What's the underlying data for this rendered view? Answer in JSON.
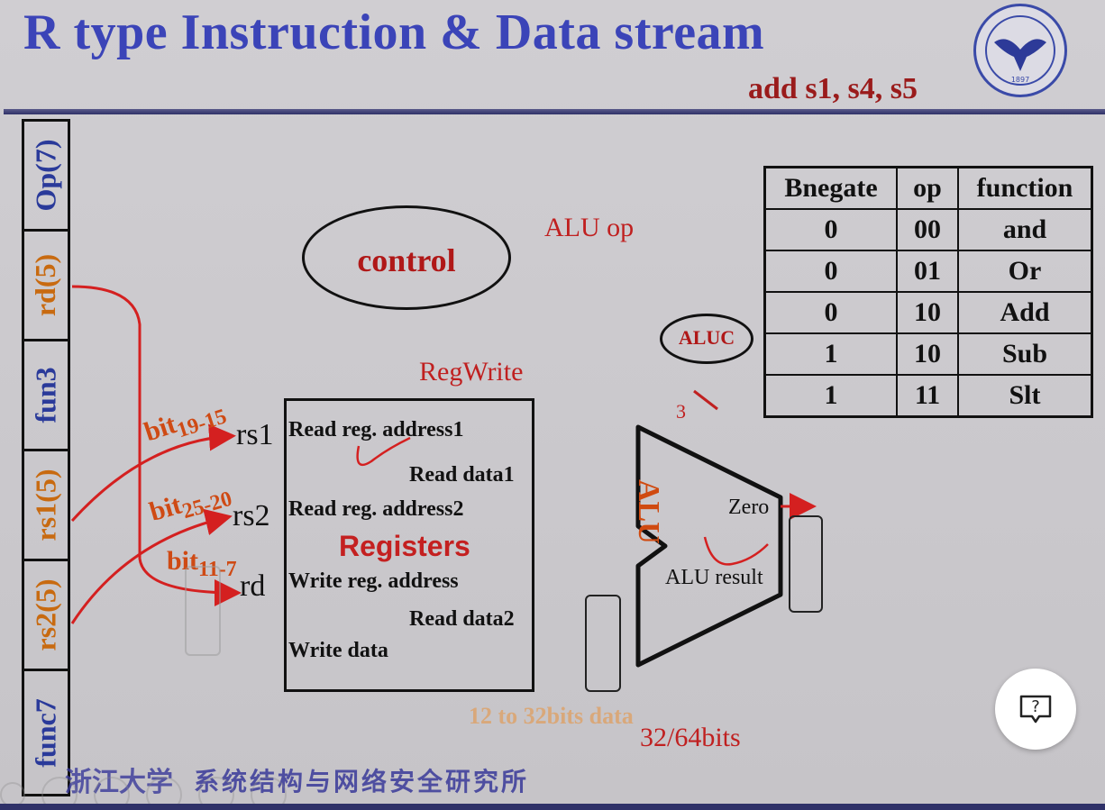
{
  "slide": {
    "title": "R type Instruction & Data stream",
    "instruction": "add  s1, s4, s5",
    "logo_text": "ZHEJIANG UNIVERSITY",
    "logo_year": "1897"
  },
  "instruction_fields": [
    {
      "label": "Op(7)",
      "color": "#2a3a9a"
    },
    {
      "label": "rd(5)",
      "color": "#c86a10"
    },
    {
      "label": "fun3",
      "color": "#2a3a9a"
    },
    {
      "label": "rs1(5)",
      "color": "#c86a10"
    },
    {
      "label": "rs2(5)",
      "color": "#c86a10"
    },
    {
      "label": "func7",
      "color": "#2a3a9a"
    }
  ],
  "control": {
    "label": "control"
  },
  "signals": {
    "alu_op": "ALU op",
    "reg_write": "RegWrite",
    "aluc": "ALUC",
    "aluc_width": "3"
  },
  "bit_labels": {
    "rs1": {
      "prefix": "bit",
      "range": "19-15"
    },
    "rs2": {
      "prefix": "bit",
      "range": "25-20"
    },
    "rd": {
      "prefix": "bit",
      "range": "11-7"
    }
  },
  "ports": {
    "rs1": "rs1",
    "rs2": "rs2",
    "rd": "rd"
  },
  "registers": {
    "name": "Registers",
    "read_addr1": "Read reg. address1",
    "read_data1": "Read data1",
    "read_addr2": "Read reg. address2",
    "write_addr": "Write reg. address",
    "read_data2": "Read data2",
    "write_data": "Write data"
  },
  "alu": {
    "label": "ALU",
    "zero": "Zero",
    "result": "ALU result"
  },
  "truth_table": {
    "headers": [
      "Bnegate",
      "op",
      "function"
    ],
    "rows": [
      [
        "0",
        "00",
        "and"
      ],
      [
        "0",
        "01",
        "Or"
      ],
      [
        "0",
        "10",
        "Add"
      ],
      [
        "1",
        "10",
        "Sub"
      ],
      [
        "1",
        "11",
        "Slt"
      ]
    ]
  },
  "notes": {
    "imm_data": "12 to 32bits data",
    "width": "32/64bits"
  },
  "footer": {
    "logo_text": "浙江大学",
    "dept": "系统结构与网络安全研究所"
  },
  "help_button": {
    "icon": "help-icon",
    "glyph": "?"
  },
  "colors": {
    "title": "#3b44b8",
    "accent_red": "#c02020",
    "bit_orange": "#cf4a14"
  }
}
